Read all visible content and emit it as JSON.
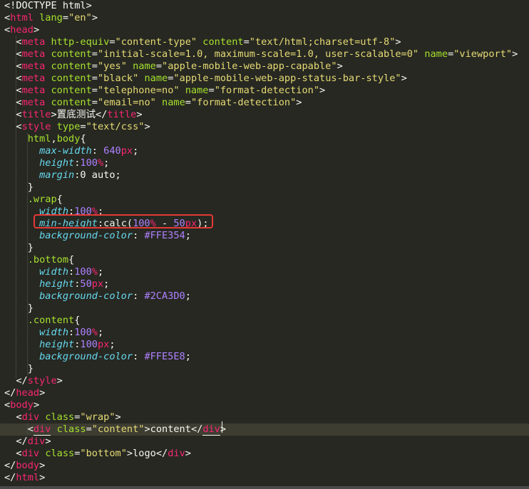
{
  "editor": {
    "colors": {
      "background": "#272822",
      "current_line": "#3e3d32",
      "highlight_box": "#e53935"
    },
    "lines": [
      [
        [
          "punct",
          "<!DOCTYPE html>"
        ]
      ],
      [
        [
          "punct",
          "<"
        ],
        [
          "tag",
          "html"
        ],
        [
          "punct",
          " "
        ],
        [
          "attr",
          "lang"
        ],
        [
          "punct",
          "="
        ],
        [
          "str",
          "\"en\""
        ],
        [
          "punct",
          ">"
        ]
      ],
      [
        [
          "punct",
          "<"
        ],
        [
          "tag",
          "head"
        ],
        [
          "punct",
          ">"
        ]
      ],
      [
        [
          "punct",
          "  <"
        ],
        [
          "tag",
          "meta"
        ],
        [
          "punct",
          " "
        ],
        [
          "attr",
          "http-equiv"
        ],
        [
          "punct",
          "="
        ],
        [
          "str",
          "\"content-type\""
        ],
        [
          "punct",
          " "
        ],
        [
          "attr",
          "content"
        ],
        [
          "punct",
          "="
        ],
        [
          "str",
          "\"text/html;charset=utf-8\""
        ],
        [
          "punct",
          ">"
        ]
      ],
      [
        [
          "punct",
          "  <"
        ],
        [
          "tag",
          "meta"
        ],
        [
          "punct",
          " "
        ],
        [
          "attr",
          "content"
        ],
        [
          "punct",
          "="
        ],
        [
          "str",
          "\"initial-scale=1.0, maximum-scale=1.0, user-scalable=0\""
        ],
        [
          "punct",
          " "
        ],
        [
          "attr",
          "name"
        ],
        [
          "punct",
          "="
        ],
        [
          "str",
          "\"viewport\""
        ],
        [
          "punct",
          ">"
        ]
      ],
      [
        [
          "punct",
          "  <"
        ],
        [
          "tag",
          "meta"
        ],
        [
          "punct",
          " "
        ],
        [
          "attr",
          "content"
        ],
        [
          "punct",
          "="
        ],
        [
          "str",
          "\"yes\""
        ],
        [
          "punct",
          " "
        ],
        [
          "attr",
          "name"
        ],
        [
          "punct",
          "="
        ],
        [
          "str",
          "\"apple-mobile-web-app-capable\""
        ],
        [
          "punct",
          ">"
        ]
      ],
      [
        [
          "punct",
          "  <"
        ],
        [
          "tag",
          "meta"
        ],
        [
          "punct",
          " "
        ],
        [
          "attr",
          "content"
        ],
        [
          "punct",
          "="
        ],
        [
          "str",
          "\"black\""
        ],
        [
          "punct",
          " "
        ],
        [
          "attr",
          "name"
        ],
        [
          "punct",
          "="
        ],
        [
          "str",
          "\"apple-mobile-web-app-status-bar-style\""
        ],
        [
          "punct",
          ">"
        ]
      ],
      [
        [
          "punct",
          "  <"
        ],
        [
          "tag",
          "meta"
        ],
        [
          "punct",
          " "
        ],
        [
          "attr",
          "content"
        ],
        [
          "punct",
          "="
        ],
        [
          "str",
          "\"telephone=no\""
        ],
        [
          "punct",
          " "
        ],
        [
          "attr",
          "name"
        ],
        [
          "punct",
          "="
        ],
        [
          "str",
          "\"format-detection\""
        ],
        [
          "punct",
          ">"
        ]
      ],
      [
        [
          "punct",
          "  <"
        ],
        [
          "tag",
          "meta"
        ],
        [
          "punct",
          " "
        ],
        [
          "attr",
          "content"
        ],
        [
          "punct",
          "="
        ],
        [
          "str",
          "\"email=no\""
        ],
        [
          "punct",
          " "
        ],
        [
          "attr",
          "name"
        ],
        [
          "punct",
          "="
        ],
        [
          "str",
          "\"format-detection\""
        ],
        [
          "punct",
          ">"
        ]
      ],
      [
        [
          "punct",
          "  <"
        ],
        [
          "tag",
          "title"
        ],
        [
          "punct",
          ">"
        ],
        [
          "text",
          "置底测试"
        ],
        [
          "punct",
          "</"
        ],
        [
          "tag",
          "title"
        ],
        [
          "punct",
          ">"
        ]
      ],
      [
        [
          "punct",
          "  <"
        ],
        [
          "tag",
          "style"
        ],
        [
          "punct",
          " "
        ],
        [
          "attr",
          "type"
        ],
        [
          "punct",
          "="
        ],
        [
          "str",
          "\"text/css\""
        ],
        [
          "punct",
          ">"
        ]
      ],
      [
        [
          "punct",
          "    "
        ],
        [
          "sel",
          "html"
        ],
        [
          "punct",
          ","
        ],
        [
          "sel",
          "body"
        ],
        [
          "punct",
          "{"
        ]
      ],
      [
        [
          "punct",
          "      "
        ],
        [
          "prop",
          "max-width"
        ],
        [
          "punct",
          ": "
        ],
        [
          "num",
          "640"
        ],
        [
          "unit",
          "px"
        ],
        [
          "punct",
          ";"
        ]
      ],
      [
        [
          "punct",
          "      "
        ],
        [
          "prop",
          "height"
        ],
        [
          "punct",
          ":"
        ],
        [
          "num",
          "100"
        ],
        [
          "unit",
          "%"
        ],
        [
          "punct",
          ";"
        ]
      ],
      [
        [
          "punct",
          "      "
        ],
        [
          "prop",
          "margin"
        ],
        [
          "punct",
          ":0 auto;"
        ]
      ],
      [
        [
          "punct",
          "    }"
        ]
      ],
      [
        [
          "punct",
          "    "
        ],
        [
          "sel",
          ".wrap"
        ],
        [
          "punct",
          "{"
        ]
      ],
      [
        [
          "punct",
          "      "
        ],
        [
          "prop",
          "width"
        ],
        [
          "punct",
          ":"
        ],
        [
          "num",
          "100"
        ],
        [
          "unit",
          "%"
        ],
        [
          "punct",
          ";"
        ]
      ],
      [
        [
          "punct",
          "      "
        ],
        [
          "prop",
          "min-height"
        ],
        [
          "punct",
          ":"
        ],
        [
          "func",
          "calc("
        ],
        [
          "num",
          "100"
        ],
        [
          "unit",
          "%"
        ],
        [
          "punct",
          " - "
        ],
        [
          "num",
          "50"
        ],
        [
          "unit",
          "px"
        ],
        [
          "func",
          ")"
        ],
        [
          "punct",
          ";"
        ]
      ],
      [
        [
          "punct",
          "      "
        ],
        [
          "prop",
          "background-color"
        ],
        [
          "punct",
          ": "
        ],
        [
          "num",
          "#FFE354"
        ],
        [
          "punct",
          ";"
        ]
      ],
      [
        [
          "punct",
          "    }"
        ]
      ],
      [
        [
          "punct",
          "    "
        ],
        [
          "sel",
          ".bottom"
        ],
        [
          "punct",
          "{"
        ]
      ],
      [
        [
          "punct",
          "      "
        ],
        [
          "prop",
          "width"
        ],
        [
          "punct",
          ":"
        ],
        [
          "num",
          "100"
        ],
        [
          "unit",
          "%"
        ],
        [
          "punct",
          ";"
        ]
      ],
      [
        [
          "punct",
          "      "
        ],
        [
          "prop",
          "height"
        ],
        [
          "punct",
          ":"
        ],
        [
          "num",
          "50"
        ],
        [
          "unit",
          "px"
        ],
        [
          "punct",
          ";"
        ]
      ],
      [
        [
          "punct",
          "      "
        ],
        [
          "prop",
          "background-color"
        ],
        [
          "punct",
          ": "
        ],
        [
          "num",
          "#2CA3D0"
        ],
        [
          "punct",
          ";"
        ]
      ],
      [
        [
          "punct",
          "    }"
        ]
      ],
      [
        [
          "punct",
          "    "
        ],
        [
          "sel",
          ".content"
        ],
        [
          "punct",
          "{"
        ]
      ],
      [
        [
          "punct",
          "      "
        ],
        [
          "prop",
          "width"
        ],
        [
          "punct",
          ":"
        ],
        [
          "num",
          "100"
        ],
        [
          "unit",
          "%"
        ],
        [
          "punct",
          ";"
        ]
      ],
      [
        [
          "punct",
          "      "
        ],
        [
          "prop",
          "height"
        ],
        [
          "punct",
          ":"
        ],
        [
          "num",
          "100"
        ],
        [
          "unit",
          "px"
        ],
        [
          "punct",
          ";"
        ]
      ],
      [
        [
          "punct",
          "      "
        ],
        [
          "prop",
          "background-color"
        ],
        [
          "punct",
          ": "
        ],
        [
          "num",
          "#FFE5E8"
        ],
        [
          "punct",
          ";"
        ]
      ],
      [
        [
          "punct",
          "    }"
        ]
      ],
      [
        [
          "punct",
          "  </"
        ],
        [
          "tag",
          "style"
        ],
        [
          "punct",
          ">"
        ]
      ],
      [
        [
          "punct",
          "</"
        ],
        [
          "tag",
          "head"
        ],
        [
          "punct",
          ">"
        ]
      ],
      [
        [
          "punct",
          "<"
        ],
        [
          "tag",
          "body"
        ],
        [
          "punct",
          ">"
        ]
      ],
      [
        [
          "punct",
          "  <"
        ],
        [
          "tag",
          "div"
        ],
        [
          "punct",
          " "
        ],
        [
          "attr",
          "class"
        ],
        [
          "punct",
          "="
        ],
        [
          "str",
          "\"wrap\""
        ],
        [
          "punct",
          ">"
        ]
      ],
      [
        [
          "punct",
          "    <"
        ],
        [
          "tag match",
          "div"
        ],
        [
          "punct",
          " "
        ],
        [
          "attr",
          "class"
        ],
        [
          "punct",
          "="
        ],
        [
          "str",
          "\"content\""
        ],
        [
          "punct",
          ">"
        ],
        [
          "text",
          "content"
        ],
        [
          "punct",
          "</"
        ],
        [
          "tag match",
          "div"
        ],
        [
          "punct",
          ">"
        ]
      ],
      [
        [
          "punct",
          "  </"
        ],
        [
          "tag",
          "div"
        ],
        [
          "punct",
          ">"
        ]
      ],
      [
        [
          "punct",
          "  <"
        ],
        [
          "tag",
          "div"
        ],
        [
          "punct",
          " "
        ],
        [
          "attr",
          "class"
        ],
        [
          "punct",
          "="
        ],
        [
          "str",
          "\"bottom\""
        ],
        [
          "punct",
          ">"
        ],
        [
          "text",
          "logo"
        ],
        [
          "punct",
          "</"
        ],
        [
          "tag",
          "div"
        ],
        [
          "punct",
          ">"
        ]
      ],
      [
        [
          "punct",
          "</"
        ],
        [
          "tag",
          "body"
        ],
        [
          "punct",
          ">"
        ]
      ],
      [
        [
          "punct",
          "</"
        ],
        [
          "tag",
          "html"
        ],
        [
          "punct",
          ">"
        ]
      ]
    ]
  }
}
